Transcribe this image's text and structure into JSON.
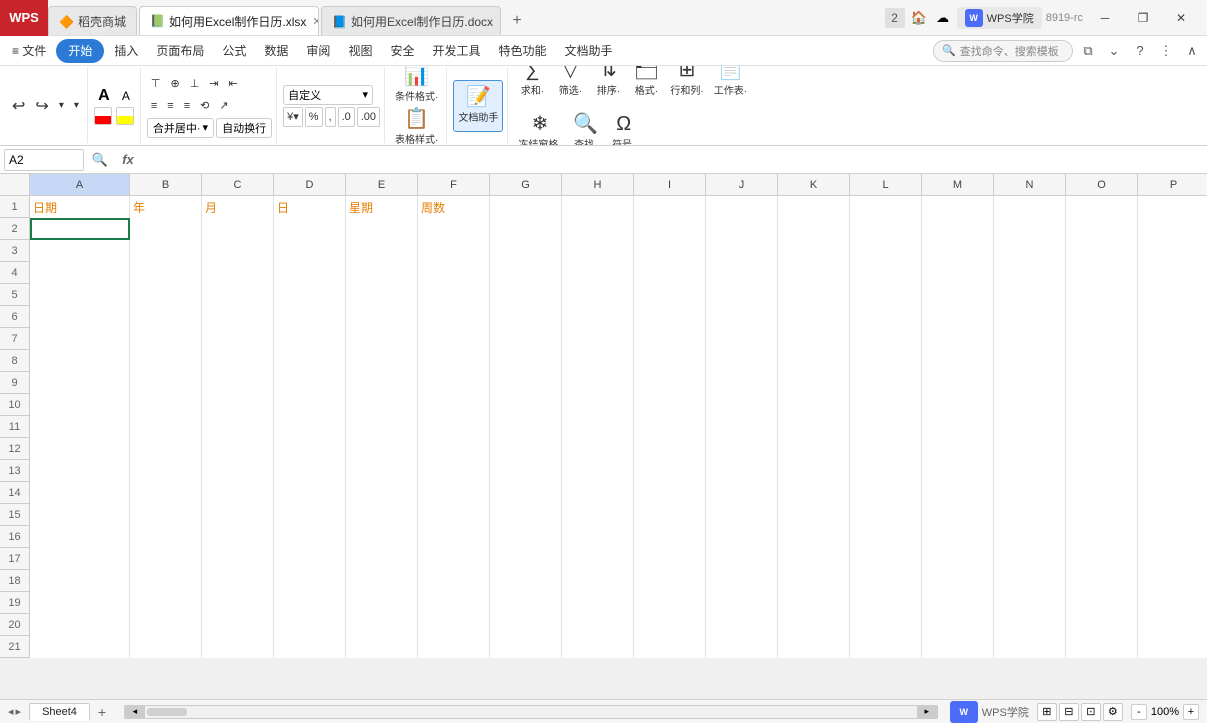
{
  "titlebar": {
    "wps_label": "WPS",
    "tabs": [
      {
        "id": "tab1",
        "label": "稻壳商城",
        "active": false,
        "icon": "🔶"
      },
      {
        "id": "tab2",
        "label": "如何用Excel制作日历.xlsx",
        "active": true,
        "icon": "📗"
      },
      {
        "id": "tab3",
        "label": "如何用Excel制作日历.docx",
        "active": false,
        "icon": "📘"
      }
    ],
    "new_tab_label": "+",
    "version": "2",
    "academy_label": "WPS学院",
    "title_suffix": "8919-rc"
  },
  "menu": {
    "items": [
      {
        "id": "file",
        "label": "≡ 文件"
      },
      {
        "id": "start",
        "label": "开始",
        "active": true
      },
      {
        "id": "insert",
        "label": "插入"
      },
      {
        "id": "page_layout",
        "label": "页面布局"
      },
      {
        "id": "formula",
        "label": "公式"
      },
      {
        "id": "data",
        "label": "数据"
      },
      {
        "id": "review",
        "label": "审阅"
      },
      {
        "id": "view",
        "label": "视图"
      },
      {
        "id": "security",
        "label": "安全"
      },
      {
        "id": "dev_tools",
        "label": "开发工具"
      },
      {
        "id": "special_func",
        "label": "特色功能"
      },
      {
        "id": "doc_assistant",
        "label": "文档助手"
      }
    ],
    "search_placeholder": "查找命令、搜索模板",
    "search_label": "查找命令、搜索模板"
  },
  "ribbon": {
    "font_a_large": "A",
    "font_a_small": "A",
    "align_btns": [
      "≡",
      "≡",
      "≡"
    ],
    "merge_label": "合并居中·",
    "wrap_label": "自动换行",
    "format_dropdown": "自定义",
    "percent_sign": "%",
    "comma": ",",
    "increase_decimal": ".0",
    "decrease_decimal": ".00",
    "conditional_format": "条件格式·",
    "table_format": "表格样式·",
    "doc_assistant_btn": "文档助手",
    "sum_btn": "求和·",
    "filter_btn": "筛选·",
    "sort_btn": "排序·",
    "format_btn": "格式·",
    "row_col_btn": "行和列·",
    "worksheet_btn": "工作表·",
    "freeze_btn": "冻结窗格·",
    "find_btn": "查找·",
    "symbol_btn": "符号·"
  },
  "formula_bar": {
    "cell_ref": "A2",
    "fx_label": "fx",
    "formula_content": ""
  },
  "spreadsheet": {
    "columns": [
      "A",
      "B",
      "C",
      "D",
      "E",
      "F",
      "G",
      "H",
      "I",
      "J",
      "K",
      "L",
      "M",
      "N",
      "O",
      "P"
    ],
    "rows": 21,
    "data": {
      "A1": "日期",
      "B1": "年",
      "C1": "月",
      "D1": "日",
      "E1": "星期",
      "F1": "周数"
    },
    "selected_cell": "A2"
  },
  "status_bar": {
    "sheet_tabs": [
      {
        "label": "Sheet4",
        "active": true
      }
    ],
    "add_sheet_label": "+",
    "wps_label": "WPS学院",
    "zoom_level": "100%",
    "zoom_out": "-",
    "zoom_in": "+"
  }
}
